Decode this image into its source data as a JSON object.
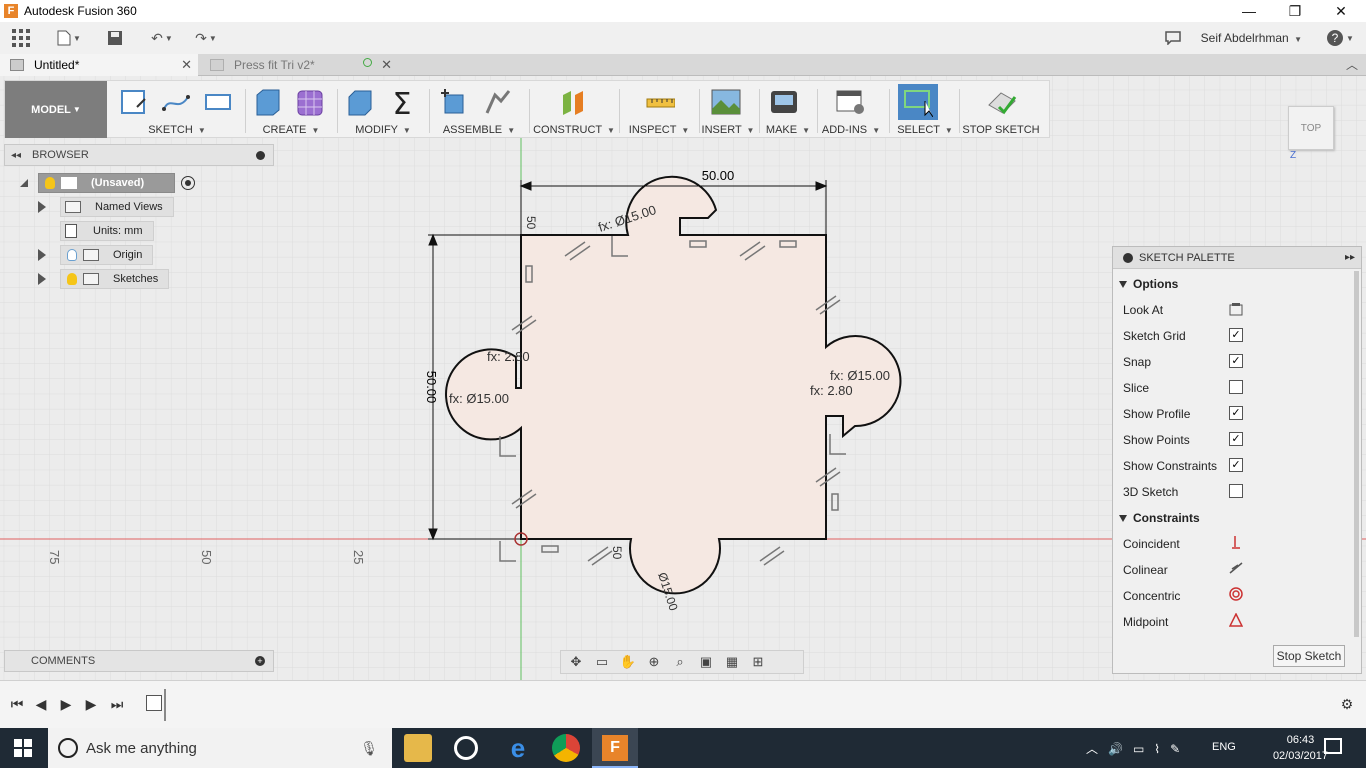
{
  "window": {
    "title": "Autodesk Fusion 360",
    "app_initial": "F"
  },
  "user": {
    "name": "Seif Abdelrhman"
  },
  "tabs": [
    {
      "label": "Untitled*",
      "active": true
    },
    {
      "label": "Press fit Tri v2*",
      "active": false
    }
  ],
  "toolbar": {
    "workspace": "MODEL",
    "groups": [
      "SKETCH",
      "CREATE",
      "MODIFY",
      "ASSEMBLE",
      "CONSTRUCT",
      "INSPECT",
      "INSERT",
      "MAKE",
      "ADD-INS",
      "SELECT",
      "STOP SKETCH"
    ]
  },
  "browser": {
    "title": "BROWSER",
    "root": "(Unsaved)",
    "items": [
      "Named Views",
      "Units: mm",
      "Origin",
      "Sketches"
    ]
  },
  "comments": {
    "title": "COMMENTS"
  },
  "viewcube": {
    "face": "TOP",
    "z_label": "Z"
  },
  "sketch": {
    "width_dim": "50.00",
    "height_dim": "50.00",
    "dim_labels": [
      "fx: Ø15.00",
      "fx: 2.80",
      "fx: Ø15.00",
      "fx: Ø15.00",
      "fx: 2.80",
      "50",
      "50",
      "Ø15.00"
    ],
    "ruler": [
      "75",
      "50",
      "25"
    ]
  },
  "palette": {
    "title": "SKETCH PALETTE",
    "options_title": "Options",
    "options": [
      {
        "label": "Look At",
        "type": "icon"
      },
      {
        "label": "Sketch Grid",
        "checked": true
      },
      {
        "label": "Snap",
        "checked": true
      },
      {
        "label": "Slice",
        "checked": false
      },
      {
        "label": "Show Profile",
        "checked": true
      },
      {
        "label": "Show Points",
        "checked": true
      },
      {
        "label": "Show Constraints",
        "checked": true
      },
      {
        "label": "3D Sketch",
        "checked": false
      }
    ],
    "constraints_title": "Constraints",
    "constraints": [
      {
        "label": "Coincident",
        "icon": "coincident-icon"
      },
      {
        "label": "Colinear",
        "icon": "colinear-icon"
      },
      {
        "label": "Concentric",
        "icon": "concentric-icon"
      },
      {
        "label": "Midpoint",
        "icon": "midpoint-icon"
      }
    ],
    "stop_button": "Stop Sketch",
    "check_mark": "✓"
  },
  "taskbar": {
    "search_placeholder": "Ask me anything",
    "lang": "ENG",
    "time": "06:43",
    "date": "02/03/2017"
  },
  "colors": {
    "accent_blue": "#4a87c5",
    "profile_fill": "#f5e8e2",
    "axis_red": "#e06060",
    "axis_green": "#60c060"
  }
}
